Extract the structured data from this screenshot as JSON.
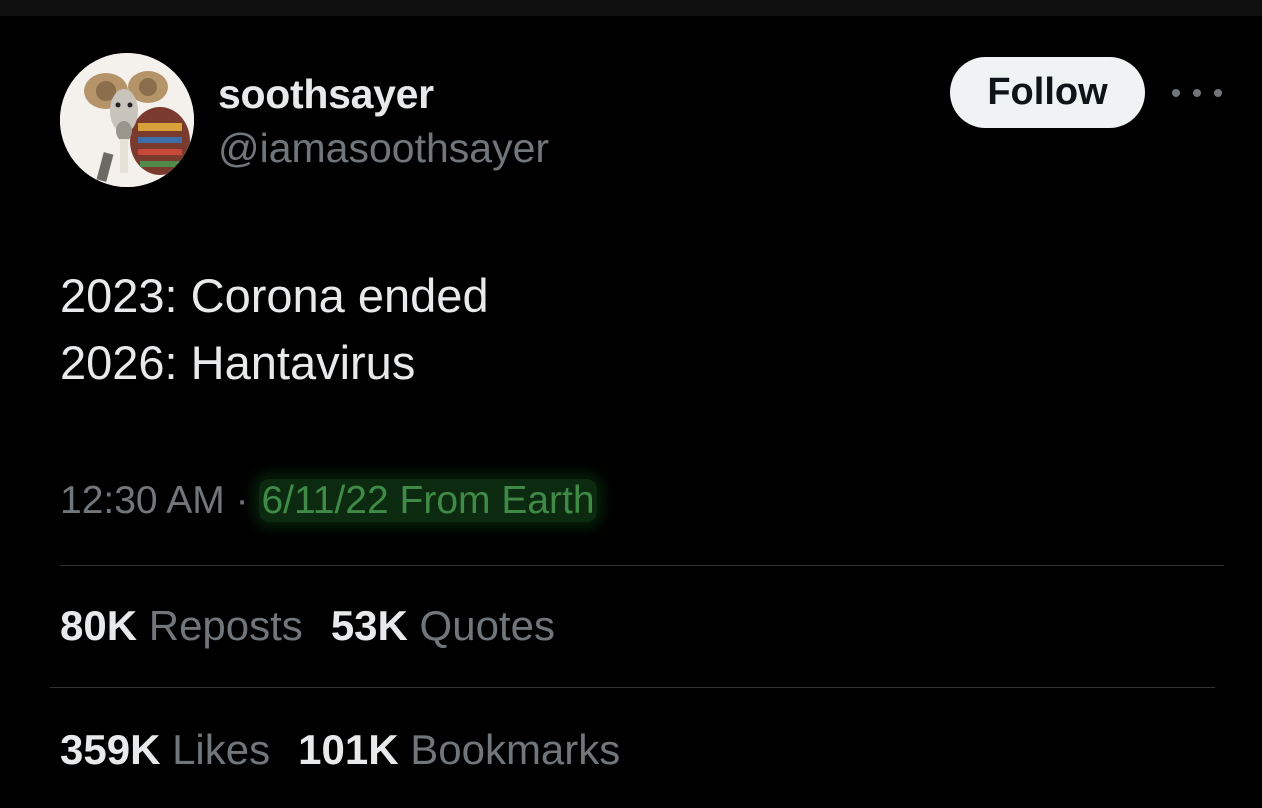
{
  "author": {
    "display_name": "soothsayer",
    "handle": "@iamasoothsayer"
  },
  "follow_label": "Follow",
  "more_icon": "more-horizontal-icon",
  "tweet": {
    "lines": [
      "2023: Corona ended",
      "2026: Hantavirus"
    ]
  },
  "meta": {
    "time": "12:30 AM",
    "separator": " · ",
    "highlighted": "6/11/22 From Earth"
  },
  "stats": {
    "reposts": {
      "count": "80K",
      "label": "Reposts"
    },
    "quotes": {
      "count": "53K",
      "label": "Quotes"
    },
    "likes": {
      "count": "359K",
      "label": "Likes"
    },
    "bookmarks": {
      "count": "101K",
      "label": "Bookmarks"
    }
  },
  "colors": {
    "background": "#000000",
    "primary_text": "#e7e9ea",
    "secondary_text": "#71767b",
    "follow_button_bg": "#eff3f4",
    "highlight_text": "#3f8a47"
  }
}
